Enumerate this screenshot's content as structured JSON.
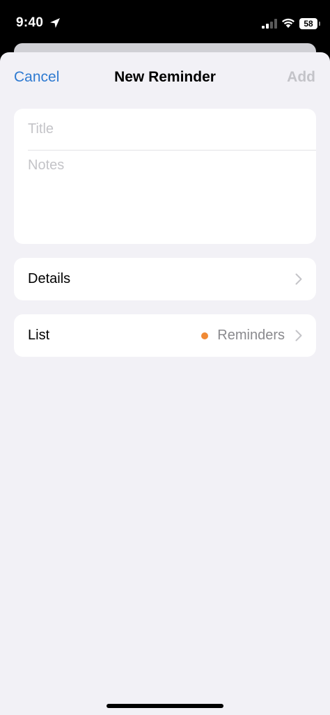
{
  "status_bar": {
    "time": "9:40",
    "battery_level": "58",
    "icons": [
      "location-arrow-icon",
      "cellular-signal-icon",
      "wifi-icon",
      "battery-icon"
    ]
  },
  "nav": {
    "cancel_label": "Cancel",
    "title": "New Reminder",
    "add_label": "Add"
  },
  "form": {
    "title_placeholder": "Title",
    "title_value": "",
    "notes_placeholder": "Notes",
    "notes_value": ""
  },
  "details": {
    "label": "Details"
  },
  "list": {
    "label": "List",
    "value": "Reminders",
    "dot_color": "#f08a35"
  },
  "colors": {
    "accent": "#2e7ad1",
    "sheet_background": "#f2f1f6",
    "disabled": "#c3c3c8",
    "secondary_text": "#8a8a8e"
  }
}
